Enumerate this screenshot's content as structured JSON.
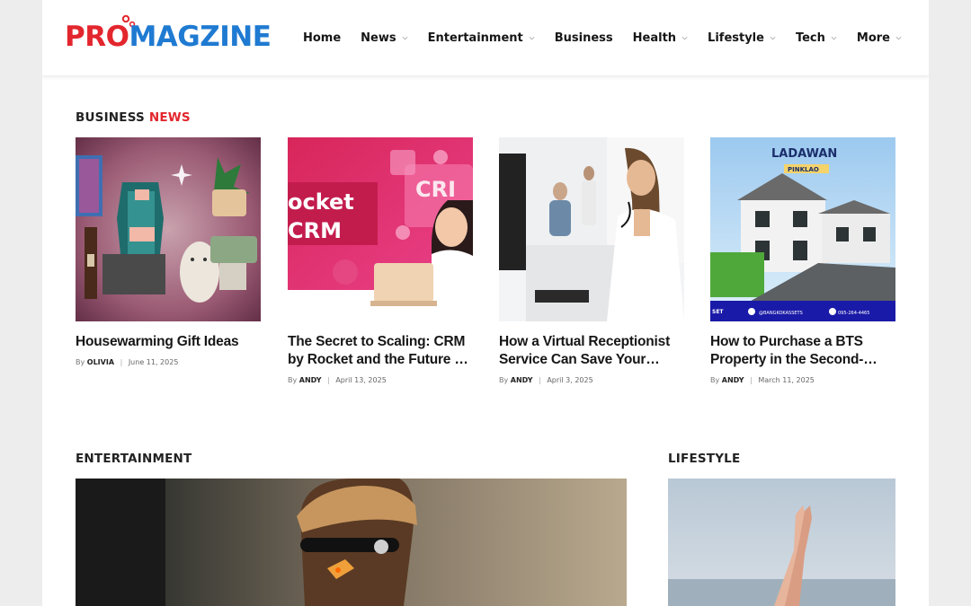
{
  "brand": {
    "logo_part1": "PRO",
    "logo_part2": "MAGZINE",
    "color_primary": "#e3262d",
    "color_secondary": "#1f7ad1"
  },
  "nav": {
    "items": [
      {
        "label": "Home",
        "has_dropdown": false
      },
      {
        "label": "News",
        "has_dropdown": true
      },
      {
        "label": "Entertainment",
        "has_dropdown": true
      },
      {
        "label": "Business",
        "has_dropdown": false
      },
      {
        "label": "Health",
        "has_dropdown": true
      },
      {
        "label": "Lifestyle",
        "has_dropdown": true
      },
      {
        "label": "Tech",
        "has_dropdown": true
      },
      {
        "label": "More",
        "has_dropdown": true
      }
    ]
  },
  "business_news": {
    "title_part1": "BUSINESS",
    "title_part2": "NEWS",
    "posts": [
      {
        "title": "Housewarming Gift Ideas",
        "by": "By",
        "author": "OLIVIA",
        "date": "June 11, 2025",
        "image": "housewarming-gifts-image"
      },
      {
        "title": "The Secret to Scaling: CRM by Rocket and the Future of Smart…",
        "by": "By",
        "author": "ANDY",
        "date": "April 13, 2025",
        "image": "rocket-crm-image",
        "image_text_1": "ocket",
        "image_text_2": "CRM",
        "image_text_3": "CRI"
      },
      {
        "title": "How a Virtual Receptionist Service Can Save Your Busines…",
        "by": "By",
        "author": "ANDY",
        "date": "April 3, 2025",
        "image": "receptionist-image"
      },
      {
        "title": "How to Purchase a BTS Property in the  Second-Hand Market",
        "by": "By",
        "author": "ANDY",
        "date": "March 11, 2025",
        "image": "property-image",
        "image_text_1": "LADAWAN",
        "image_text_2": "PINKLAO",
        "image_text_3": "@BANGKOKASSETS",
        "image_text_4": "095-264-4465",
        "image_text_5": "SET"
      }
    ]
  },
  "entertainment": {
    "title": "ENTERTAINMENT"
  },
  "lifestyle": {
    "title": "LIFESTYLE"
  }
}
